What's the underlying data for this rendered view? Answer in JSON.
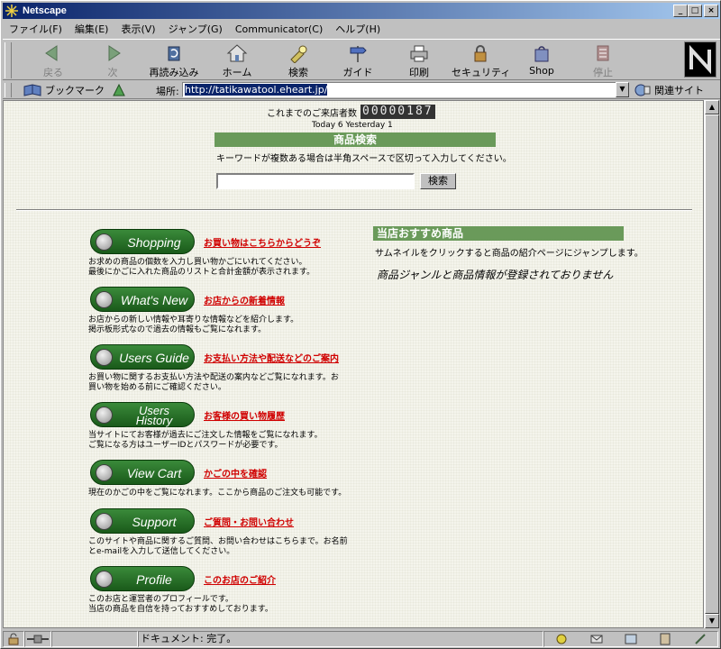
{
  "window": {
    "title": "Netscape"
  },
  "menu": [
    "ファイル(F)",
    "編集(E)",
    "表示(V)",
    "ジャンプ(G)",
    "Communicator(C)",
    "ヘルプ(H)"
  ],
  "toolbar": {
    "back": "戻る",
    "forward": "次",
    "reload": "再読み込み",
    "home": "ホーム",
    "search": "検索",
    "guide": "ガイド",
    "print": "印刷",
    "security": "セキュリティ",
    "shop": "Shop",
    "stop": "停止"
  },
  "locbar": {
    "bookmarks": "ブックマーク",
    "label": "場所:",
    "url": "http://tatikawatool.eheart.jp/",
    "related": "関連サイト"
  },
  "page": {
    "counter_label": "これまでのご来店者数",
    "counter_value": "00000187",
    "today_yesterday": "Today 6  Yesterday 1",
    "search_title": "商品検索",
    "search_hint": "キーワードが複数ある場合は半角スペースで区切って入力してください。",
    "search_button": "検索",
    "nav": [
      {
        "pill": "Shopping",
        "link": "お買い物はこちらからどうぞ",
        "desc": "お求めの商品の個数を入力し買い物かごにいれてください。\n最後にかごに入れた商品のリストと合計金額が表示されます。"
      },
      {
        "pill": "What's New",
        "link": "お店からの新着情報",
        "desc": "お店からの新しい情報や耳寄りな情報などを紹介します。\n掲示板形式なので過去の情報もご覧になれます。"
      },
      {
        "pill": "Users Guide",
        "link": "お支払い方法や配送などのご案内",
        "desc": "お買い物に関するお支払い方法や配送の案内などご覧になれます。お\n買い物を始める前にご確認ください。"
      },
      {
        "pill": "Users\nHistory",
        "link": "お客様の買い物履歴",
        "desc": "当サイトにてお客様が過去にご注文した情報をご覧になれます。\nご覧になる方はユーザーIDとパスワードが必要です。"
      },
      {
        "pill": "View Cart",
        "link": "かごの中を確認",
        "desc": "現在のかごの中をご覧になれます。ここから商品のご注文も可能です。"
      },
      {
        "pill": "Support",
        "link": "ご質問・お問い合わせ",
        "desc": "このサイトや商品に関するご質問、お問い合わせはこちらまで。お名前\nとe-mailを入力して送信してください。"
      },
      {
        "pill": "Profile",
        "link": "このお店のご紹介",
        "desc": "このお店と運営者のプロフィールです。\n当店の商品を自信を持っておすすめしております。"
      }
    ],
    "recommend_title": "当店おすすめ商品",
    "recommend_hint": "サムネイルをクリックすると商品の紹介ページにジャンプします。",
    "recommend_empty": "商品ジャンルと商品情報が登録されておりません"
  },
  "status": {
    "text": "ドキュメント: 完了。"
  },
  "colors": {
    "accent_green": "#6a9a5a",
    "link_red": "#d00000",
    "titlebar": "#0a246a"
  }
}
